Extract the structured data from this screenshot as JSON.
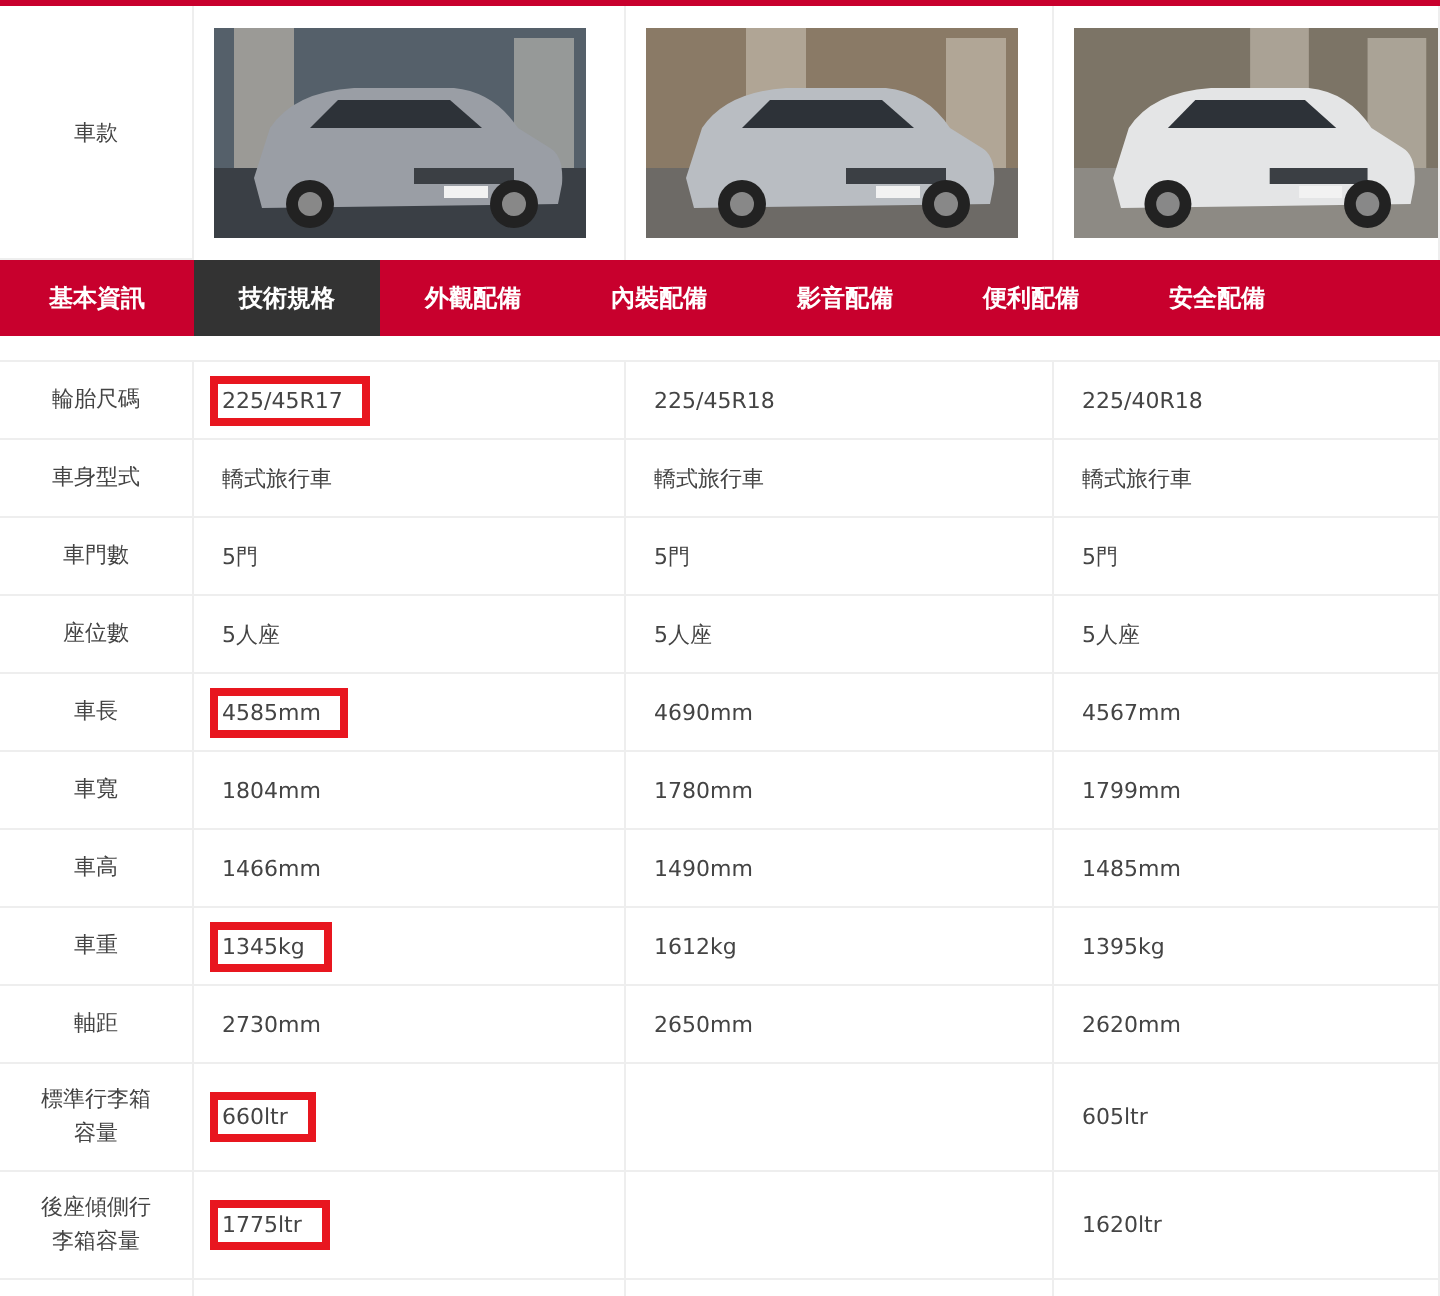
{
  "models_row": {
    "label": "車款"
  },
  "tabs": [
    {
      "label": "基本資訊",
      "selected": false
    },
    {
      "label": "技術規格",
      "selected": true
    },
    {
      "label": "外觀配備",
      "selected": false
    },
    {
      "label": "內裝配備",
      "selected": false
    },
    {
      "label": "影音配備",
      "selected": false
    },
    {
      "label": "便利配備",
      "selected": false
    },
    {
      "label": "安全配備",
      "selected": false
    }
  ],
  "rows": [
    {
      "label": "輪胎尺碼",
      "cells": [
        {
          "text": "225/45R17",
          "highlighted": true
        },
        {
          "text": "225/45R18",
          "highlighted": false
        },
        {
          "text": "225/40R18",
          "highlighted": false
        }
      ]
    },
    {
      "label": "車身型式",
      "cells": [
        {
          "text": "轎式旅行車",
          "highlighted": false
        },
        {
          "text": "轎式旅行車",
          "highlighted": false
        },
        {
          "text": "轎式旅行車",
          "highlighted": false
        }
      ]
    },
    {
      "label": "車門數",
      "cells": [
        {
          "text": "5門",
          "highlighted": false
        },
        {
          "text": "5門",
          "highlighted": false
        },
        {
          "text": "5門",
          "highlighted": false
        }
      ]
    },
    {
      "label": "座位數",
      "cells": [
        {
          "text": "5人座",
          "highlighted": false
        },
        {
          "text": "5人座",
          "highlighted": false
        },
        {
          "text": "5人座",
          "highlighted": false
        }
      ]
    },
    {
      "label": "車長",
      "cells": [
        {
          "text": "4585mm",
          "highlighted": true
        },
        {
          "text": "4690mm",
          "highlighted": false
        },
        {
          "text": "4567mm",
          "highlighted": false
        }
      ]
    },
    {
      "label": "車寬",
      "cells": [
        {
          "text": "1804mm",
          "highlighted": false
        },
        {
          "text": "1780mm",
          "highlighted": false
        },
        {
          "text": "1799mm",
          "highlighted": false
        }
      ]
    },
    {
      "label": "車高",
      "cells": [
        {
          "text": "1466mm",
          "highlighted": false
        },
        {
          "text": "1490mm",
          "highlighted": false
        },
        {
          "text": "1485mm",
          "highlighted": false
        }
      ]
    },
    {
      "label": "車重",
      "cells": [
        {
          "text": "1345kg",
          "highlighted": true
        },
        {
          "text": "1612kg",
          "highlighted": false
        },
        {
          "text": "1395kg",
          "highlighted": false
        }
      ]
    },
    {
      "label": "軸距",
      "cells": [
        {
          "text": "2730mm",
          "highlighted": false
        },
        {
          "text": "2650mm",
          "highlighted": false
        },
        {
          "text": "2620mm",
          "highlighted": false
        }
      ]
    },
    {
      "label": "標準行李箱容量",
      "cells": [
        {
          "text": "660ltr",
          "highlighted": true
        },
        {},
        {
          "text": "605ltr",
          "highlighted": false
        }
      ]
    },
    {
      "label": "後座傾側行李箱容量",
      "cells": [
        {
          "text": "1775ltr",
          "highlighted": true
        },
        {},
        {
          "text": "1620ltr",
          "highlighted": false
        }
      ]
    }
  ]
}
